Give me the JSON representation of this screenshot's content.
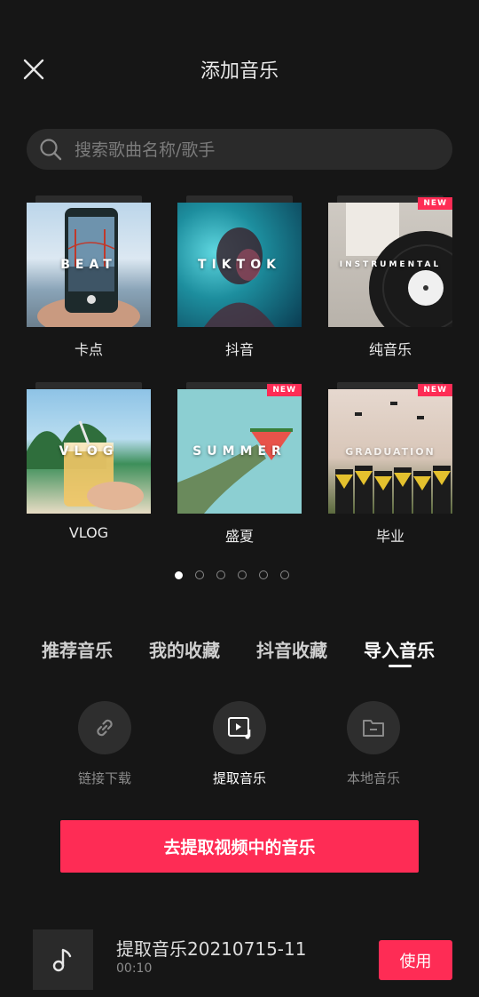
{
  "header": {
    "title": "添加音乐"
  },
  "search": {
    "placeholder": "搜索歌曲名称/歌手"
  },
  "categories": [
    {
      "label": "卡点",
      "cover_text": "BEAT"
    },
    {
      "label": "抖音",
      "cover_text": "TIKTOK"
    },
    {
      "label": "纯音乐",
      "cover_text": "INSTRUMENTAL",
      "badge": "NEW"
    },
    {
      "label": "VLOG",
      "cover_text": "VLOG"
    },
    {
      "label": "盛夏",
      "cover_text": "SUMMER",
      "badge": "NEW"
    },
    {
      "label": "毕业",
      "cover_text": "GRADUATION",
      "badge": "NEW"
    }
  ],
  "pagination": {
    "pages": 6,
    "current": 1
  },
  "tabs": [
    {
      "label": "推荐音乐"
    },
    {
      "label": "我的收藏"
    },
    {
      "label": "抖音收藏"
    },
    {
      "label": "导入音乐",
      "active": true
    }
  ],
  "import_options": [
    {
      "label": "链接下载",
      "icon": "link-icon"
    },
    {
      "label": "提取音乐",
      "icon": "video-music-icon",
      "active": true
    },
    {
      "label": "本地音乐",
      "icon": "folder-icon"
    }
  ],
  "cta": {
    "label": "去提取视频中的音乐"
  },
  "track": {
    "title": "提取音乐20210715-11",
    "duration": "00:10",
    "use_label": "使用",
    "icon": "music-note-icon"
  },
  "colors": {
    "background": "#161616",
    "accent": "#fe2c55"
  }
}
